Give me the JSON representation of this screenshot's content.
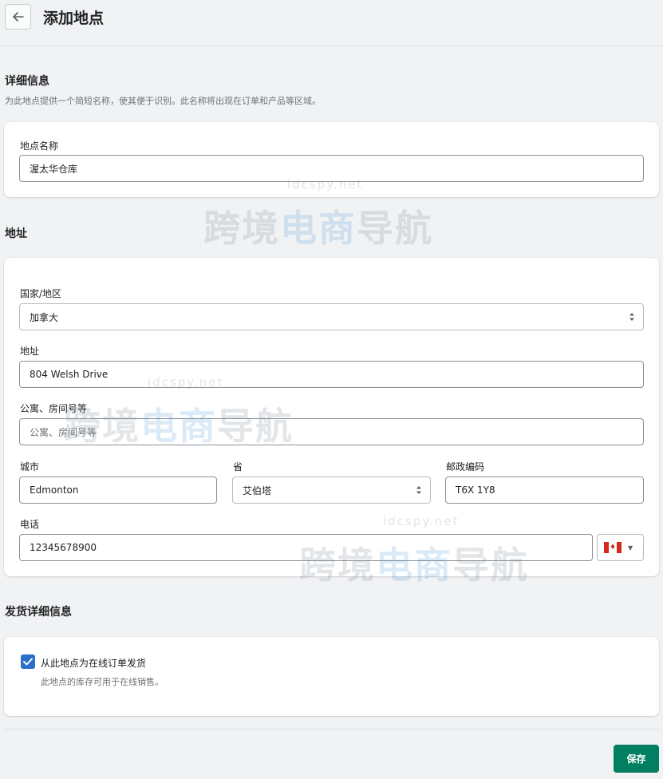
{
  "header": {
    "title": "添加地点"
  },
  "details": {
    "title": "详细信息",
    "description": "为此地点提供一个简短名称，使其便于识别。此名称将出现在订单和产品等区域。",
    "name_label": "地点名称",
    "name_value": "渥太华仓库"
  },
  "address": {
    "title": "地址",
    "country_label": "国家/地区",
    "country_value": "加拿大",
    "address_label": "地址",
    "address_value": "804 Welsh Drive",
    "apartment_label": "公寓、房间号等",
    "apartment_placeholder": "公寓、房间号等",
    "city_label": "城市",
    "city_value": "Edmonton",
    "province_label": "省",
    "province_value": "艾伯塔",
    "postal_label": "邮政编码",
    "postal_value": "T6X 1Y8",
    "phone_label": "电话",
    "phone_value": "12345678900",
    "phone_country_icon": "canada-flag-icon"
  },
  "fulfillment": {
    "title": "发货详细信息",
    "checkbox_label": "从此地点为在线订单发货",
    "checkbox_checked": true,
    "checkbox_help": "此地点的库存可用于在线销售。"
  },
  "footer": {
    "save_label": "保存"
  },
  "watermark": {
    "text_prefix": "跨境",
    "text_accent": "电商",
    "text_suffix": "导航",
    "url": "idcspy.net"
  },
  "colors": {
    "background": "#f1f2f4",
    "primary_button": "#008060",
    "checkbox": "#2c6ecb"
  }
}
